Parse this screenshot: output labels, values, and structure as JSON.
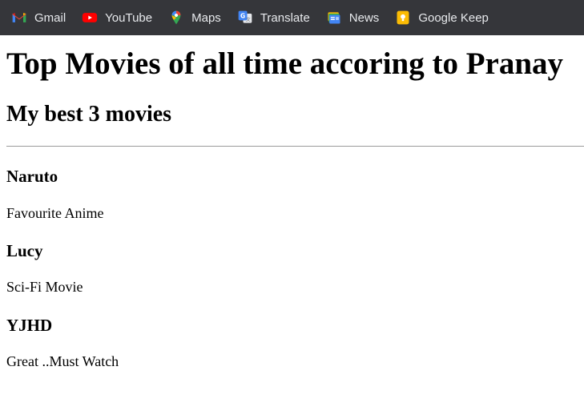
{
  "bookmarks": [
    {
      "label": "Gmail",
      "icon": "gmail-icon"
    },
    {
      "label": "YouTube",
      "icon": "youtube-icon"
    },
    {
      "label": "Maps",
      "icon": "maps-icon"
    },
    {
      "label": "Translate",
      "icon": "translate-icon"
    },
    {
      "label": "News",
      "icon": "news-icon"
    },
    {
      "label": "Google Keep",
      "icon": "keep-icon"
    }
  ],
  "page": {
    "title": "Top Movies of all time accoring to Pranay",
    "subtitle": "My best 3 movies"
  },
  "movies": [
    {
      "title": "Naruto",
      "description": "Favourite Anime"
    },
    {
      "title": "Lucy",
      "description": "Sci-Fi Movie"
    },
    {
      "title": "YJHD",
      "description": "Great ..Must Watch"
    }
  ],
  "colors": {
    "bookmarks_bar_bg": "#35363a",
    "bookmarks_text": "#e8eaed",
    "divider": "#9a9a9a"
  }
}
